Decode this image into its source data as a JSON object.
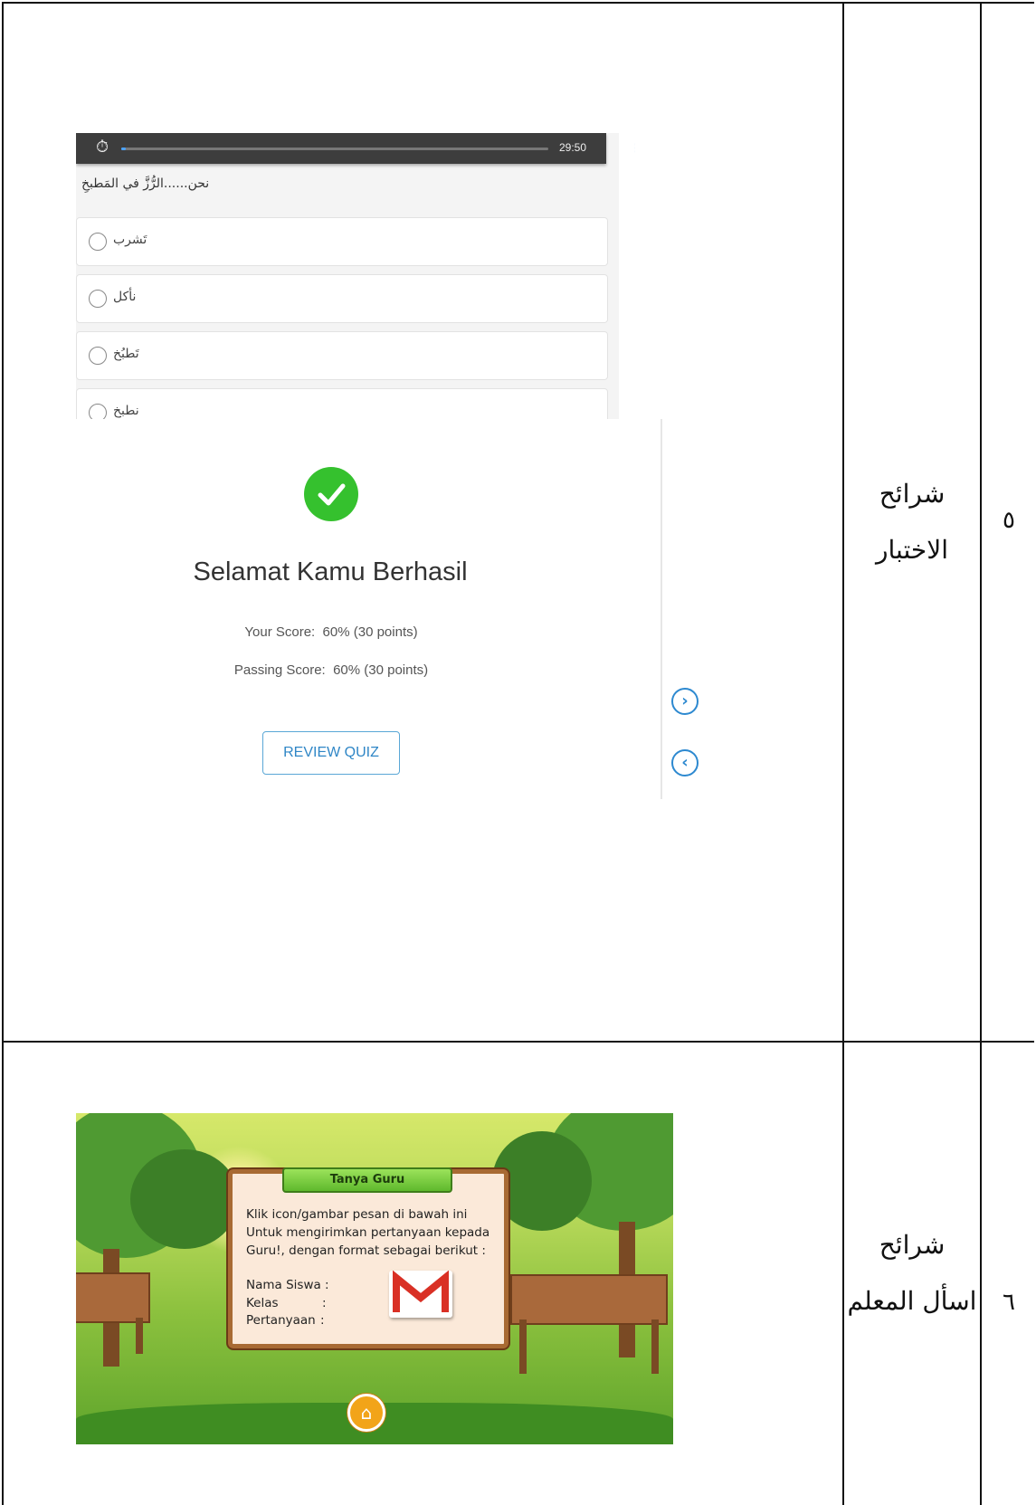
{
  "table": {
    "rows": [
      {
        "number": "٥",
        "label_line1": "شرائح",
        "label_line2": "الاختبار"
      },
      {
        "number": "٦",
        "label_line1": "شرائح",
        "label_line2": "اسأل المعلم"
      }
    ]
  },
  "quiz": {
    "timer": "29:50",
    "question": "نحن......الرُّزَّ في المَطبخِ",
    "options": [
      "تَشرب",
      "نأكل",
      "تَطبُخ",
      "نطبخ"
    ],
    "progress": 0.01
  },
  "result": {
    "title": "Selamat Kamu Berhasil",
    "your_score_label": "Your Score:",
    "your_score_value": "60% (30 points)",
    "passing_score_label": "Passing Score:",
    "passing_score_value": "60% (30 points)",
    "review_button": "REVIEW QUIZ"
  },
  "game": {
    "dialog_title": "Tanya Guru",
    "instruction_line1": "Klik icon/gambar pesan di bawah ini",
    "instruction_line2": "Untuk mengirimkan pertanyaan kepada",
    "instruction_line3": "Guru!, dengan format sebagai berikut :",
    "field_name": "Nama Siswa :",
    "field_class": "Kelas",
    "field_question": "Pertanyaan",
    "colon": ":"
  },
  "colors": {
    "accent_blue": "#2d89d0",
    "success_green": "#35c12e",
    "game_orange": "#f2a419"
  }
}
